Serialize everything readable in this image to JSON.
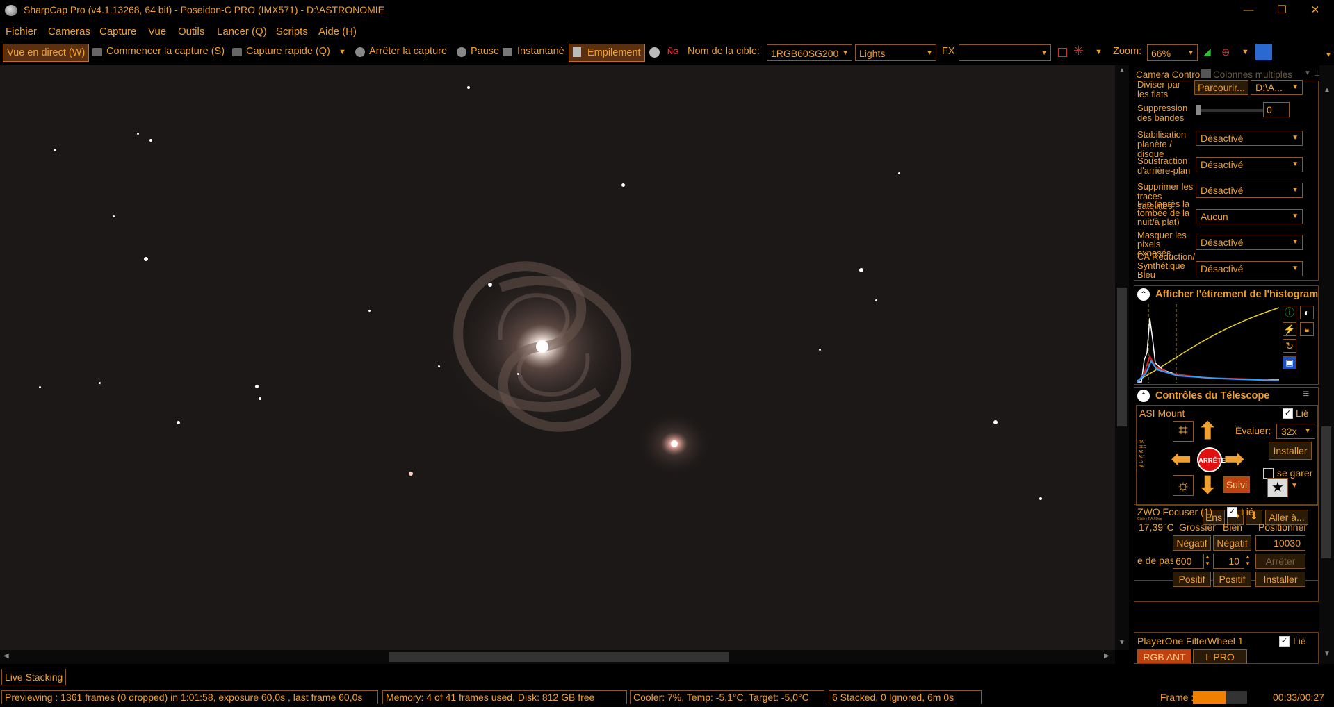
{
  "window": {
    "title": "SharpCap Pro (v4.1.13268, 64 bit) - Poseidon-C PRO (IMX571) - D:\\ASTRONOMIE",
    "min_glyph": "—",
    "max_glyph": "❐",
    "close_glyph": "✕"
  },
  "menu": [
    "Fichier",
    "Cameras",
    "Capture",
    "Vue",
    "Outils",
    "Lancer (Q)",
    "Scripts",
    "Aide (H)"
  ],
  "toolbar": {
    "live_view": "Vue en direct (W)",
    "start_capture": "Commencer la capture (S)",
    "quick_capture": "Capture rapide (Q)",
    "stop_capture": "Arrêter la capture",
    "pause": "Pause",
    "snapshot": "Instantané",
    "stacking": "Empilement",
    "target_label": "Nom de la cible:",
    "target_value": "1RGB60SG200",
    "frame_type": "Lights",
    "fx_label": "FX",
    "fx_value": "",
    "zoom_label": "Zoom:",
    "zoom_value": "66%"
  },
  "camera_controls": {
    "tab_title": "Camera Controls",
    "tab_columns": "Colonnes multiples",
    "rows": [
      {
        "label": "Diviser par les flats",
        "browse": "Parcourir...",
        "path": "D:\\A..."
      },
      {
        "label": "Suppression des bandes",
        "value": "0"
      },
      {
        "label": "Stabilisation planète / disque",
        "value": "Désactivé"
      },
      {
        "label": "Soustraction d'arrière-plan",
        "value": "Désactivé"
      },
      {
        "label": "Supprimer les traces satellites",
        "value": "Désactivé"
      },
      {
        "label": "Flip (après la tombée de la nuit/à plat)",
        "value": "Aucun"
      },
      {
        "label": "Masquer les pixels exposés",
        "value": "Désactivé"
      },
      {
        "label": "CA Réduction/ Synthétique Bleu",
        "value": "Désactivé"
      }
    ]
  },
  "histogram": {
    "title": "Afficher l'étirement de l'histogram"
  },
  "telescope": {
    "title": "Contrôles du Télescope",
    "mount": "ASI Mount",
    "linked": "Lié",
    "rate_label": "Évaluer:",
    "rate_value": "32x",
    "install": "Installer",
    "park": "se garer",
    "stop": "ARRÊTE",
    "track": "Suivi",
    "ens": "Ens",
    "goto": "Aller à..."
  },
  "focuser": {
    "title": "ZWO Focuser (1)",
    "linked": "Lié",
    "temp": "17,39°C",
    "coarse": "Grossier",
    "fine": "Bien",
    "position_label": "Positionner",
    "neg1": "Négatif",
    "neg2": "Négatif",
    "position": "10030",
    "step_label": "e de pas",
    "coarse_step": "600",
    "fine_step": "10",
    "stop": "Arrêter",
    "pos1": "Positif",
    "pos2": "Positif",
    "install": "Installer"
  },
  "filterwheel": {
    "title": "PlayerOne FilterWheel 1",
    "linked": "Lié",
    "filter_a": "RGB ANT",
    "filter_b": "L PRO"
  },
  "live_stacking_tab": "Live Stacking",
  "status": {
    "preview": "Previewing : 1361 frames (0 dropped) in 1:01:58, exposure 60,0s , last frame 60,0s",
    "memory": "Memory: 4 of 41 frames used, Disk: 812 GB free",
    "cooler": "Cooler: 7%, Temp: -5,1°C, Target: -5,0°C",
    "stacked": "6 Stacked, 0 Ignored, 6m 0s",
    "frame_label": "Frame :",
    "frame_progress": 0.6,
    "time": "00:33/00:27"
  },
  "colors": {
    "accent": "#f0a030",
    "sky": "#1b1817",
    "stop_red": "#e01010"
  }
}
